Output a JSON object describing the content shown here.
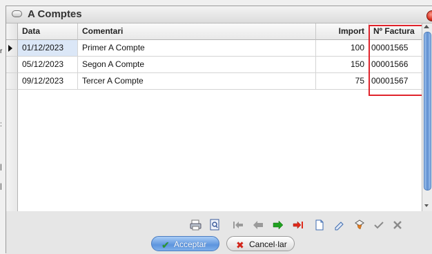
{
  "window": {
    "title": "A Comptes"
  },
  "grid": {
    "columns": [
      {
        "key": "data",
        "label": "Data"
      },
      {
        "key": "comentari",
        "label": "Comentari"
      },
      {
        "key": "import",
        "label": "Import"
      },
      {
        "key": "factura",
        "label": "Nº Factura"
      }
    ],
    "rows": [
      {
        "data": "01/12/2023",
        "comentari": "Primer A Compte",
        "import": "100",
        "factura": "00001565",
        "current": true
      },
      {
        "data": "05/12/2023",
        "comentari": "Segon A Compte",
        "import": "150",
        "factura": "00001566",
        "current": false
      },
      {
        "data": "09/12/2023",
        "comentari": "Tercer A Compte",
        "import": "75",
        "factura": "00001567",
        "current": false
      }
    ]
  },
  "toolbar": {
    "icons": [
      "print-icon",
      "preview-icon",
      "first-record-icon",
      "previous-record-icon",
      "next-record-icon",
      "last-record-icon",
      "new-record-icon",
      "edit-record-icon",
      "clear-filter-icon",
      "confirm-icon",
      "cancel-icon"
    ],
    "colors": {
      "next": "#1fa01f",
      "last": "#e02a1a",
      "nav_disabled": "#9a9a9a",
      "confirm": "#8a8a8a"
    }
  },
  "buttons": {
    "ok_label": "Acceptar",
    "cancel_label": "Cancel·lar"
  }
}
